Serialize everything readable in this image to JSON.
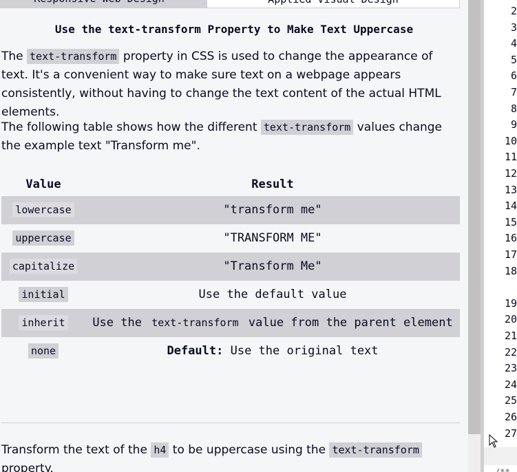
{
  "breadcrumb": {
    "superblock": "Responsive Web Design",
    "block": "Applied Visual Design"
  },
  "challenge": {
    "title": "Use the text-transform Property to Make Text Uppercase",
    "intro": {
      "before": "The ",
      "code": "text-transform",
      "after": " property in CSS is used to change the appearance of text. It's a convenient way to make sure text on a webpage appears consistently, without having to change the text content of the actual HTML elements."
    },
    "table_intro": {
      "before": "The following table shows how the different ",
      "code": "text-transform",
      "after": " values change the example text \"Transform me\"."
    },
    "table": {
      "headers": [
        "Value",
        "Result"
      ],
      "rows": [
        {
          "value": "lowercase",
          "result": "\"transform me\""
        },
        {
          "value": "uppercase",
          "result": "\"TRANSFORM ME\""
        },
        {
          "value": "capitalize",
          "result": "\"Transform Me\""
        },
        {
          "value": "initial",
          "result": "Use the default value"
        },
        {
          "value": "inherit",
          "result_before": "Use the ",
          "result_code": "text-transform",
          "result_after": " value from the parent element"
        },
        {
          "value": "none",
          "result_bold": "Default:",
          "result_after": " Use the original text"
        }
      ]
    },
    "task": {
      "before": "Transform the text of the ",
      "code1": "h4",
      "middle": " to be uppercase using the ",
      "code2": "text-transform",
      "after": " property."
    }
  },
  "editor": {
    "line_numbers": [
      "2",
      "3",
      "4",
      "5",
      "6",
      "7",
      "8",
      "9",
      "10",
      "11",
      "12",
      "13",
      "14",
      "15",
      "16",
      "17",
      "18",
      "",
      "19",
      "20",
      "21",
      "22",
      "23",
      "24",
      "25",
      "26",
      "27"
    ],
    "console_peek": "/**"
  },
  "colors": {
    "pane_bg": "#f5f6f7",
    "code_bg": "#d0d0d5",
    "text": "#0a0a23",
    "stripe": "#d0d0d5"
  }
}
